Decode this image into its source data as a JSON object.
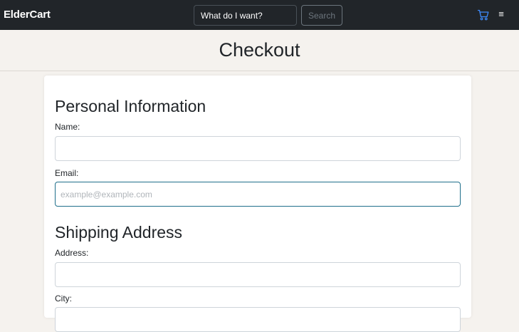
{
  "navbar": {
    "brand": "ElderCart",
    "search_placeholder": "What do I want?",
    "search_button": "Search",
    "cart_icon": "cart-icon",
    "menu_icon": "menu-icon",
    "menu_glyph": "≡"
  },
  "header": {
    "title": "Checkout"
  },
  "form": {
    "personal": {
      "title": "Personal Information",
      "name_label": "Name:",
      "name_value": "",
      "email_label": "Email:",
      "email_placeholder": "example@example.com",
      "email_value": ""
    },
    "shipping": {
      "title": "Shipping Address",
      "address_label": "Address:",
      "address_value": "",
      "city_label": "City:",
      "city_value": ""
    }
  },
  "colors": {
    "navbar": "#212529",
    "background": "#f5f2ee",
    "accent": "#1f6f8b",
    "cart_icon": "#3d8bfd"
  }
}
